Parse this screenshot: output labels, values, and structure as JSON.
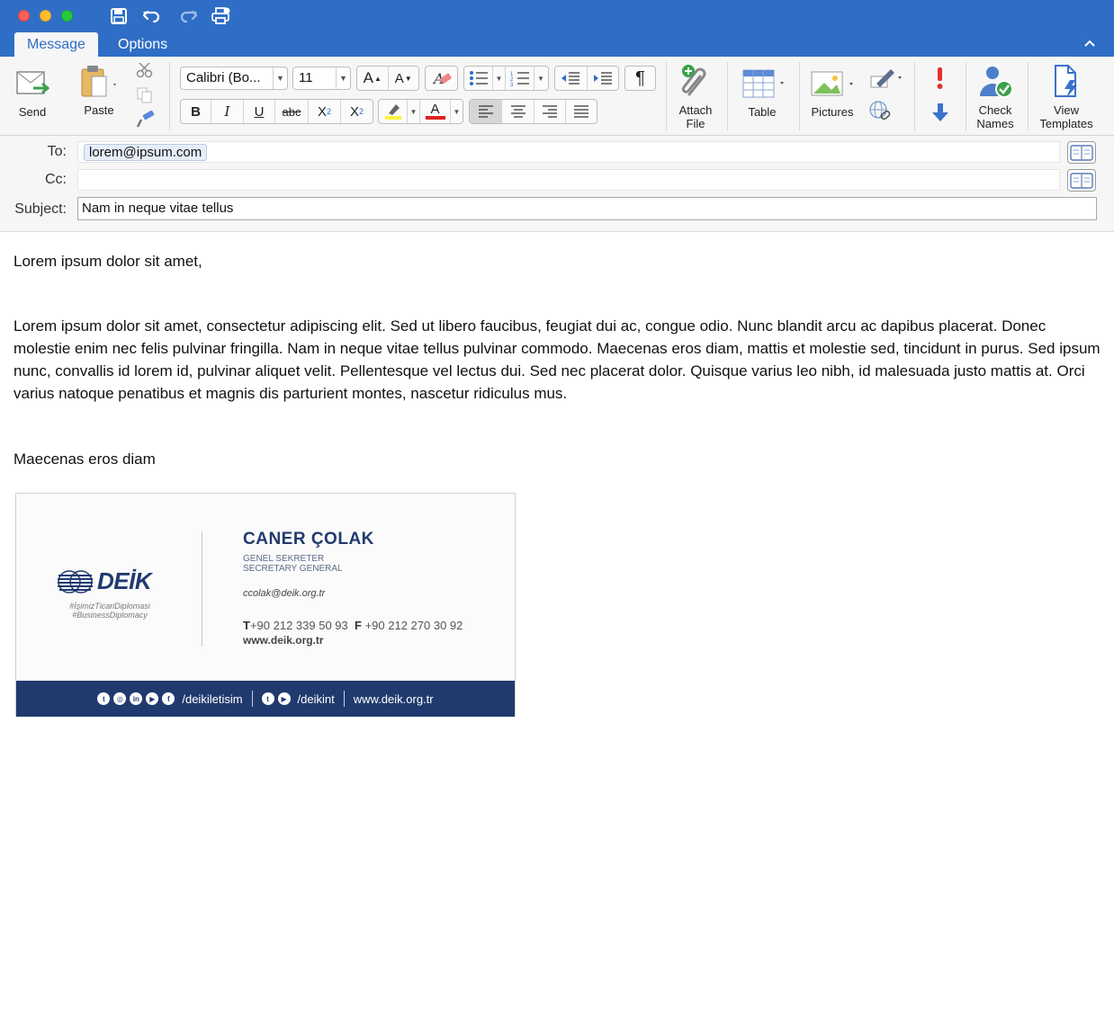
{
  "tabs": [
    {
      "label": "Message",
      "active": true
    },
    {
      "label": "Options",
      "active": false
    }
  ],
  "ribbon": {
    "send_label": "Send",
    "paste_label": "Paste",
    "font_name": "Calibri (Bo...",
    "font_size": "11",
    "attach_label_1": "Attach",
    "attach_label_2": "File",
    "table_label": "Table",
    "pictures_label": "Pictures",
    "check_names_1": "Check",
    "check_names_2": "Names",
    "view_templates_1": "View",
    "view_templates_2": "Templates",
    "bold": "B",
    "italic": "I",
    "underline": "U",
    "strike": "abc",
    "subscript": "X",
    "subscript_mark": "2",
    "superscript": "X",
    "superscript_mark": "2",
    "font_color": "A",
    "pilcrow": "¶",
    "grow": "A",
    "shrink": "A"
  },
  "fields": {
    "to_label": "To:",
    "cc_label": "Cc:",
    "subject_label": "Subject:",
    "to_value": "lorem@ipsum.com",
    "cc_value": "",
    "subject_value": "Nam in neque vitae tellus"
  },
  "body": {
    "greeting": "Lorem ipsum dolor sit amet,",
    "paragraph": "Lorem ipsum dolor sit amet, consectetur adipiscing elit. Sed ut libero faucibus, feugiat dui ac, congue odio. Nunc blandit arcu ac dapibus placerat. Donec molestie enim nec felis pulvinar fringilla. Nam in neque vitae tellus pulvinar commodo. Maecenas eros diam, mattis et molestie sed, tincidunt in purus. Sed ipsum nunc, convallis id lorem id, pulvinar aliquet velit. Pellentesque vel lectus dui. Sed nec placerat dolor. Quisque varius leo nibh, id malesuada justo mattis at. Orci varius natoque penatibus et magnis dis parturient montes, nascetur ridiculus mus.",
    "signoff": "Maecenas eros diam"
  },
  "signature": {
    "logo_text": "DEİK",
    "tag1": "#İşimizTicariDiplomasi",
    "tag2": "#BusinessDiplomacy",
    "name": "CANER ÇOLAK",
    "title_tr": "GENEL SEKRETER",
    "title_en": "SECRETARY GENERAL",
    "email": "ccolak@deik.org.tr",
    "phone_t_label": "T",
    "phone_t": "+90 212 339 50 93",
    "phone_f_label": "F",
    "phone_f": "+90 212 270 30 92",
    "website": "www.deik.org.tr",
    "social1": "/deikiletisim",
    "social2": "/deikint",
    "footer_web": "www.deik.org.tr"
  },
  "colors": {
    "accent": "#2f6ec6",
    "brand_navy": "#213a6e"
  },
  "icons": {
    "collapse": "chevron-up-icon",
    "save": "save-icon",
    "undo": "undo-icon",
    "redo": "redo-icon",
    "print": "print-icon"
  }
}
